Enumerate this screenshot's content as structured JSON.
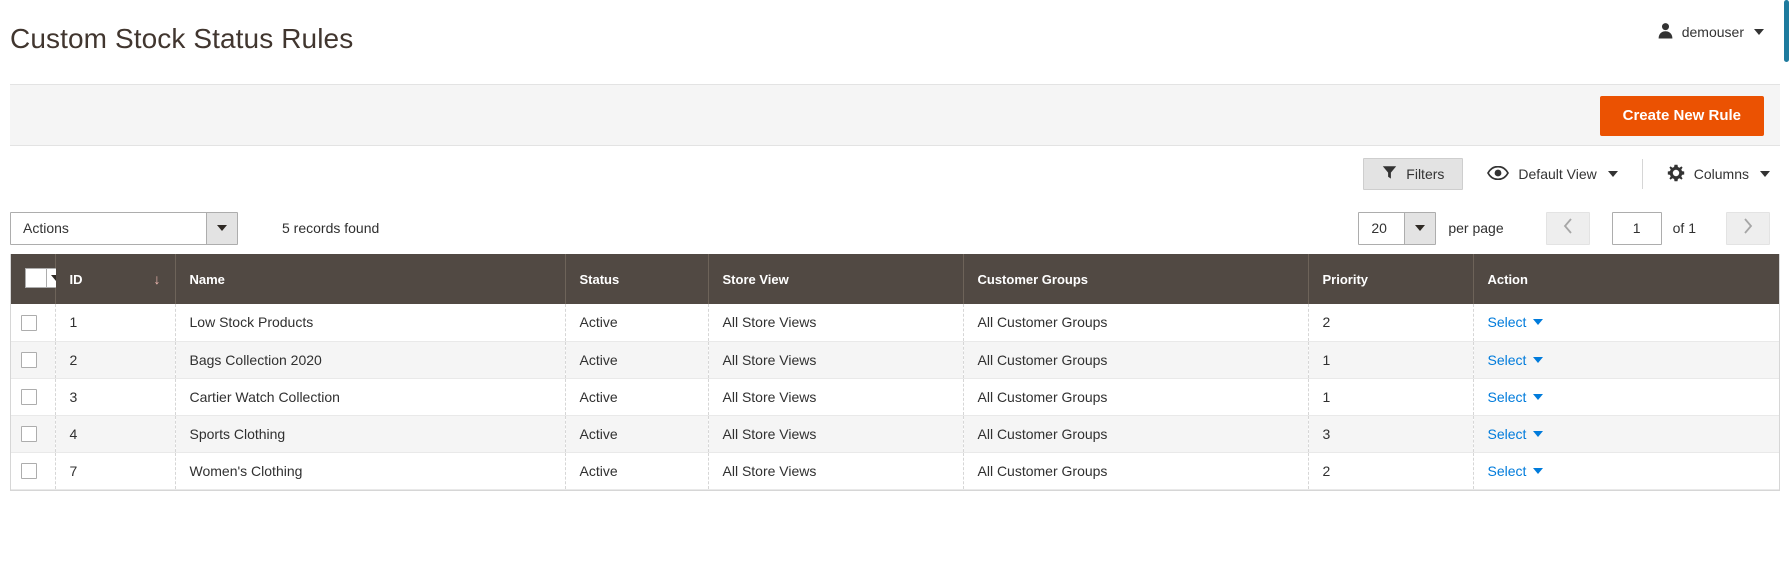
{
  "header": {
    "title": "Custom Stock Status Rules",
    "user_name": "demouser",
    "user_icon": "user-icon",
    "caret_icon": "chevron-down-icon"
  },
  "page_actions": {
    "create_label": "Create New Rule"
  },
  "toolbar": {
    "filters_label": "Filters",
    "filters_icon": "funnel-icon",
    "view_label": "Default View",
    "view_icon": "eye-icon",
    "columns_label": "Columns",
    "columns_icon": "gear-icon"
  },
  "grid_controls": {
    "actions_label": "Actions",
    "records_found": "5 records found",
    "per_page_value": "20",
    "per_page_label": "per page",
    "page_value": "1",
    "of_pages": "of 1",
    "prev_icon": "chevron-left-icon",
    "next_icon": "chevron-right-icon"
  },
  "grid": {
    "columns": [
      {
        "key": "check",
        "label": ""
      },
      {
        "key": "id",
        "label": "ID"
      },
      {
        "key": "name",
        "label": "Name"
      },
      {
        "key": "status",
        "label": "Status"
      },
      {
        "key": "store_view",
        "label": "Store View"
      },
      {
        "key": "customer_groups",
        "label": "Customer Groups"
      },
      {
        "key": "priority",
        "label": "Priority"
      },
      {
        "key": "action",
        "label": "Action"
      }
    ],
    "sorted_column": "ID",
    "sort_direction": "desc",
    "sort_glyph": "↓",
    "action_label": "Select",
    "rows": [
      {
        "id": "1",
        "name": "Low Stock Products",
        "status": "Active",
        "store_view": "All Store Views",
        "customer_groups": "All Customer Groups",
        "priority": "2",
        "action": "Select"
      },
      {
        "id": "2",
        "name": "Bags Collection 2020",
        "status": "Active",
        "store_view": "All Store Views",
        "customer_groups": "All Customer Groups",
        "priority": "1",
        "action": "Select"
      },
      {
        "id": "3",
        "name": "Cartier Watch Collection",
        "status": "Active",
        "store_view": "All Store Views",
        "customer_groups": "All Customer Groups",
        "priority": "1",
        "action": "Select"
      },
      {
        "id": "4",
        "name": "Sports Clothing",
        "status": "Active",
        "store_view": "All Store Views",
        "customer_groups": "All Customer Groups",
        "priority": "3",
        "action": "Select"
      },
      {
        "id": "7",
        "name": "Women's Clothing",
        "status": "Active",
        "store_view": "All Store Views",
        "customer_groups": "All Customer Groups",
        "priority": "2",
        "action": "Select"
      }
    ]
  },
  "colors": {
    "primary_button": "#eb5202",
    "header_row": "#514943",
    "link": "#007bdb",
    "title_text": "#41362f",
    "scrollbar": "#1e7b9e"
  }
}
